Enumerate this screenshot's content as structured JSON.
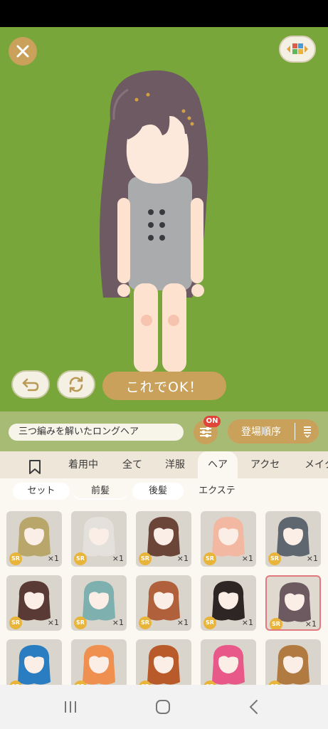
{
  "toolbar": {
    "ok_label": "これでOK！"
  },
  "filter": {
    "item_name": "三つ編みを解いたロングヘア",
    "badge": "ON",
    "sort_label": "登場順序"
  },
  "category_tabs": [
    "着用中",
    "全て",
    "洋服",
    "ヘア",
    "アクセ",
    "メイク"
  ],
  "active_category": "ヘア",
  "sub_tabs": [
    "セット",
    "前髪",
    "後髪",
    "エクステ"
  ],
  "active_sub_tab": "前髪",
  "items": [
    {
      "rarity": "SR",
      "count": "×1",
      "hair": "#b9a66a"
    },
    {
      "rarity": "SR",
      "count": "×1",
      "hair": "#e4e1dc"
    },
    {
      "rarity": "SR",
      "count": "×1",
      "hair": "#6b4638"
    },
    {
      "rarity": "SR",
      "count": "×1",
      "hair": "#f3b8a2"
    },
    {
      "rarity": "SR",
      "count": "×1",
      "hair": "#5e6670"
    },
    {
      "rarity": "SR",
      "count": "×1",
      "hair": "#5a3a34"
    },
    {
      "rarity": "SR",
      "count": "×1",
      "hair": "#7fb0b0"
    },
    {
      "rarity": "SR",
      "count": "×1",
      "hair": "#b0603a"
    },
    {
      "rarity": "SR",
      "count": "×1",
      "hair": "#2e2624"
    },
    {
      "rarity": "SR",
      "count": "×1",
      "hair": "#6c5a60",
      "selected": true
    },
    {
      "rarity": "SR",
      "count": "",
      "hair": "#2a7dc0"
    },
    {
      "rarity": "SR",
      "count": "",
      "hair": "#f09050"
    },
    {
      "rarity": "SR",
      "count": "",
      "hair": "#b85a2a"
    },
    {
      "rarity": "SR",
      "count": "",
      "hair": "#e85888"
    },
    {
      "rarity": "SR",
      "count": "",
      "hair": "#b07a40"
    }
  ],
  "colors": {
    "stage_bg": "#78a63a",
    "accent_gold": "#c9a15a",
    "badge_red": "#e0453a",
    "avatar_hair": "#6d5a62",
    "outfit": "#a9abac"
  },
  "icons": {
    "close": "close-icon",
    "bg_switch": "palette-icon",
    "undo": "undo-icon",
    "rotate": "rotate-icon",
    "filter": "sliders-icon",
    "sort": "sort-icon",
    "bookmark": "bookmark-icon",
    "nav_recent": "recent-apps-icon",
    "nav_home": "home-icon",
    "nav_back": "back-icon"
  }
}
